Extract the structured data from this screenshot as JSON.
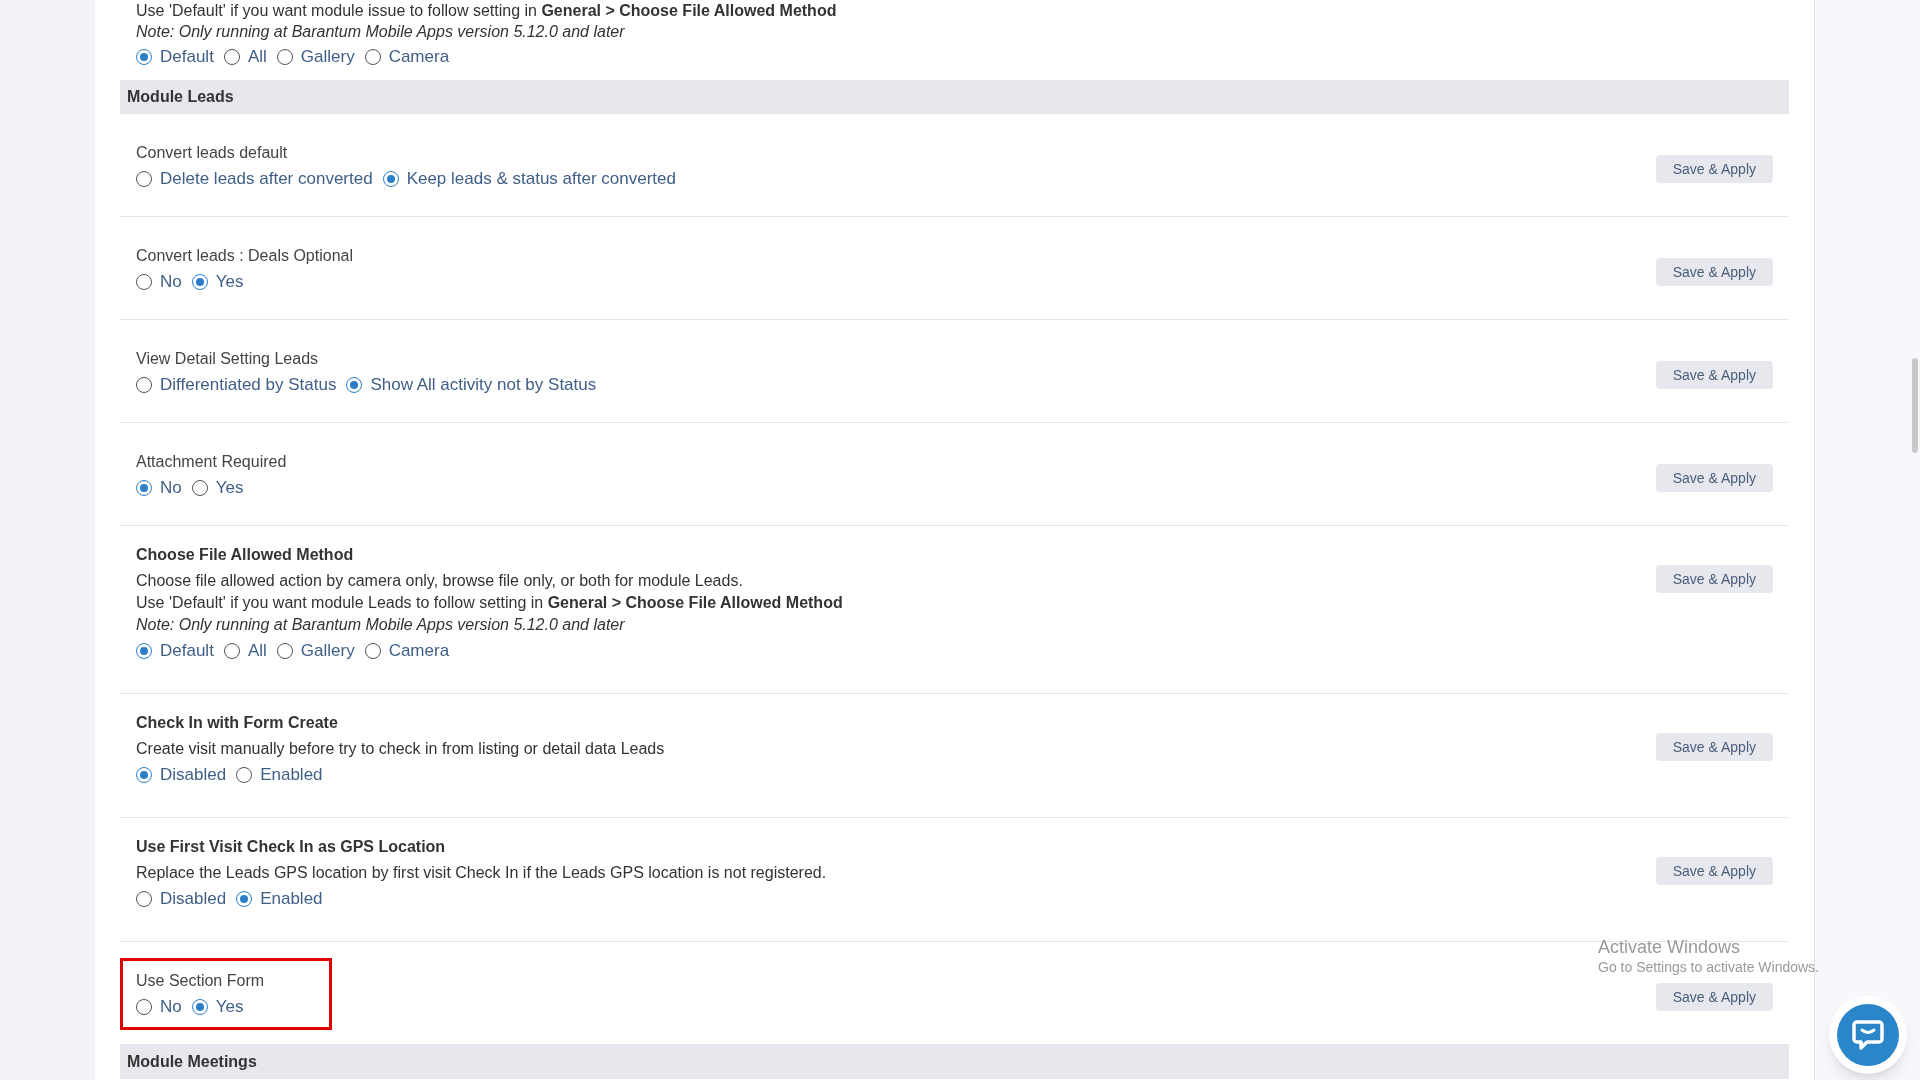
{
  "top_partial": {
    "lines": [
      "Use 'Default' if you want module issue to follow setting in **General > Choose File Allowed Method**"
    ],
    "note": "Note: Only running at Barantum Mobile Apps version 5.12.0 and later",
    "options": [
      {
        "label": "Default",
        "selected": true
      },
      {
        "label": "All",
        "selected": false
      },
      {
        "label": "Gallery",
        "selected": false
      },
      {
        "label": "Camera",
        "selected": false
      }
    ]
  },
  "sections": [
    {
      "title": "Module Leads",
      "settings": [
        {
          "kind": "simple",
          "title": "Convert leads default",
          "options": [
            {
              "label": "Delete leads after converted",
              "selected": false
            },
            {
              "label": "Keep leads & status after converted",
              "selected": true
            }
          ],
          "button": "Save & Apply",
          "highlighted": false
        },
        {
          "kind": "simple",
          "title": "Convert leads : Deals Optional",
          "options": [
            {
              "label": "No",
              "selected": false
            },
            {
              "label": "Yes",
              "selected": true
            }
          ],
          "button": "Save & Apply",
          "highlighted": false
        },
        {
          "kind": "simple",
          "title": "View Detail Setting Leads",
          "options": [
            {
              "label": "Differentiated by Status",
              "selected": false
            },
            {
              "label": "Show All activity not by Status",
              "selected": true
            }
          ],
          "button": "Save & Apply",
          "highlighted": false
        },
        {
          "kind": "simple",
          "title": "Attachment Required",
          "options": [
            {
              "label": "No",
              "selected": true
            },
            {
              "label": "Yes",
              "selected": false
            }
          ],
          "button": "Save & Apply",
          "highlighted": false
        },
        {
          "kind": "detailed",
          "title": "Choose File Allowed Method",
          "lines": [
            "Choose file allowed action by camera only, browse file only, or both for module Leads.",
            "Use 'Default' if you want module Leads to follow setting in **General > Choose File Allowed Method**"
          ],
          "note": "Note: Only running at Barantum Mobile Apps version 5.12.0 and later",
          "options": [
            {
              "label": "Default",
              "selected": true
            },
            {
              "label": "All",
              "selected": false
            },
            {
              "label": "Gallery",
              "selected": false
            },
            {
              "label": "Camera",
              "selected": false
            }
          ],
          "button": "Save & Apply",
          "highlighted": false
        },
        {
          "kind": "detailed",
          "title": "Check In with Form Create",
          "lines": [
            "Create visit manually before try to check in from listing or detail data Leads"
          ],
          "options": [
            {
              "label": "Disabled",
              "selected": true
            },
            {
              "label": "Enabled",
              "selected": false
            }
          ],
          "button": "Save & Apply",
          "highlighted": false
        },
        {
          "kind": "detailed",
          "title": "Use First Visit Check In as GPS Location",
          "lines": [
            "Replace the Leads GPS location by first visit Check In if the Leads GPS location is not registered."
          ],
          "options": [
            {
              "label": "Disabled",
              "selected": false
            },
            {
              "label": "Enabled",
              "selected": true
            }
          ],
          "button": "Save & Apply",
          "highlighted": false
        },
        {
          "kind": "simple",
          "title": "Use Section Form",
          "options": [
            {
              "label": "No",
              "selected": false
            },
            {
              "label": "Yes",
              "selected": true
            }
          ],
          "button": "Save & Apply",
          "highlighted": true
        }
      ]
    },
    {
      "title": "Module Meetings"
    }
  ],
  "os_notice": {
    "title": "Activate Windows",
    "subtitle": "Go to Settings to activate Windows."
  }
}
